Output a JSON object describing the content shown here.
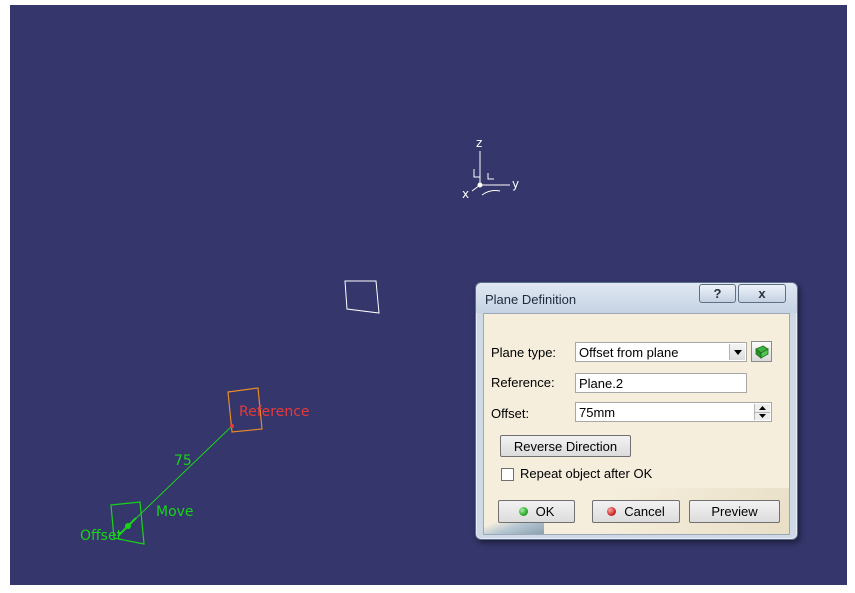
{
  "scene": {
    "axes": {
      "z_label": "z",
      "y_label": "y",
      "x_label": "x"
    },
    "labels": {
      "reference": "Reference",
      "offset_value": "75",
      "move": "Move",
      "offset": "Offset"
    },
    "colors": {
      "background": "#35366b",
      "reference": "#e53a3a",
      "handle": "#18d418",
      "reference_plane": "#e88a2a",
      "axes": "#ffffff"
    }
  },
  "dialog": {
    "title": "Plane Definition",
    "help_label": "?",
    "close_label": "x",
    "plane_type": {
      "label": "Plane type:",
      "value": "Offset from plane"
    },
    "reference": {
      "label": "Reference:",
      "value": "Plane.2"
    },
    "offset": {
      "label": "Offset:",
      "value": "75mm"
    },
    "reverse_direction_label": "Reverse Direction",
    "repeat_object": {
      "label": "Repeat object after OK",
      "checked": false
    },
    "ok_label": "OK",
    "cancel_label": "Cancel",
    "preview_label": "Preview",
    "ok_color": "#2ea82e",
    "cancel_color": "#d12b2b"
  }
}
